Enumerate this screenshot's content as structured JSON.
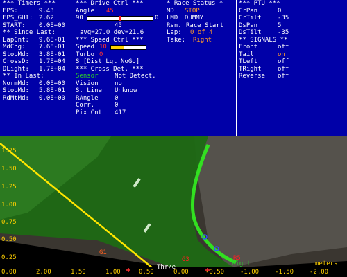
{
  "timers": {
    "header": "*** Timers ***",
    "rows": [
      {
        "label": "FPS:",
        "value": "9.43"
      },
      {
        "label": "FPS_GUI:",
        "value": "2.62"
      },
      {
        "label": "START:",
        "value": "0.0E+00"
      }
    ],
    "since_header": "** Since Last:",
    "since_rows": [
      {
        "label": "LapCnt:",
        "value": "9.6E-01"
      },
      {
        "label": "MdChg:",
        "value": "7.6E-01"
      },
      {
        "label": "StopMd:",
        "value": "3.8E-01"
      },
      {
        "label": "CrossD:",
        "value": "1.7E+04"
      },
      {
        "label": "DLight:",
        "value": "1.7E+04"
      }
    ],
    "in_header": "** In Last:",
    "in_rows": [
      {
        "label": "NormMd:",
        "value": "0.0E+00"
      },
      {
        "label": "StopMd:",
        "value": "5.8E-01"
      },
      {
        "label": "RdMtMd:",
        "value": "0.0E+00"
      }
    ]
  },
  "drive": {
    "header": "***  Drive Ctrl  ***",
    "angle_label": "Angle",
    "angle_value": "45",
    "bar_left": "90",
    "bar_right": "0",
    "bar_value_label": "45",
    "avg_text": "avg=27.0  dev=21.6",
    "speed_header": "***  Speed Ctrl  ***",
    "speed_label": "Speed",
    "speed_value": "10",
    "turbo_label": "Turbo",
    "turbo_value": "0",
    "s_text": "S [Dist Lgt NoGo]",
    "cross_header": "*** Cross Det. ***",
    "cross_rows": [
      {
        "label": "Sensor",
        "value": "Not Detect."
      },
      {
        "label": "Vision",
        "value": "no"
      },
      {
        "label": "S. Line",
        "value": "Unknow"
      },
      {
        "label": "RAngle",
        "value": "0"
      },
      {
        "label": "Corr.",
        "value": "0"
      },
      {
        "label": "Pix Cnt",
        "value": "417"
      }
    ],
    "angle_fill_fraction": 0.5,
    "speed_fill_fraction": 0.35
  },
  "race": {
    "header": "* Race Status *",
    "rows": [
      {
        "label": "MD",
        "value": "STOP"
      },
      {
        "label": "LMD",
        "value": "DUMMY"
      },
      {
        "label": "Rsn.",
        "value": "Race Start"
      },
      {
        "label": "Lap:",
        "value": "0 of 4"
      },
      {
        "label": "Take:",
        "value": "Right"
      }
    ]
  },
  "ptu": {
    "header": "*** PTU ***",
    "rows": [
      {
        "label": "CrPan",
        "value": "0"
      },
      {
        "label": "CrTilt",
        "value": "-35"
      },
      {
        "label": "DsPan",
        "value": "5"
      },
      {
        "label": "DsTilt",
        "value": "-35"
      }
    ],
    "signals_header": "** SIGNALS **",
    "signals": [
      {
        "label": "Front",
        "value": "off"
      },
      {
        "label": "Tail",
        "value": "on"
      },
      {
        "label": "TLeft",
        "value": "off"
      },
      {
        "label": "TRight",
        "value": "off"
      },
      {
        "label": "Reverse",
        "value": "off"
      }
    ]
  },
  "view": {
    "y_ticks": [
      "1.75",
      "1.50",
      "1.25",
      "1.00",
      "0.75",
      "0.50",
      "0.25",
      "0.00"
    ],
    "x_ticks": [
      "2.00",
      "1.50",
      "1.00",
      "0.50",
      "0.00",
      "-0.50",
      "-1.00",
      "-1.50",
      "-2.00"
    ],
    "units": "meters",
    "markers": [
      {
        "label": "G1",
        "color": "#ff6020"
      },
      {
        "label": "G3",
        "color": "#ff2020"
      },
      {
        "label": "R5",
        "color": "#ff2020"
      },
      {
        "label": "Right",
        "color": "#2ad02a"
      },
      {
        "label": "Thr/e",
        "color": "#ffffff"
      }
    ],
    "colors": {
      "lane": "#2ecc1a",
      "field": "#1e6a14",
      "guide": "#ffe600",
      "ticks": "#ffd000"
    }
  }
}
